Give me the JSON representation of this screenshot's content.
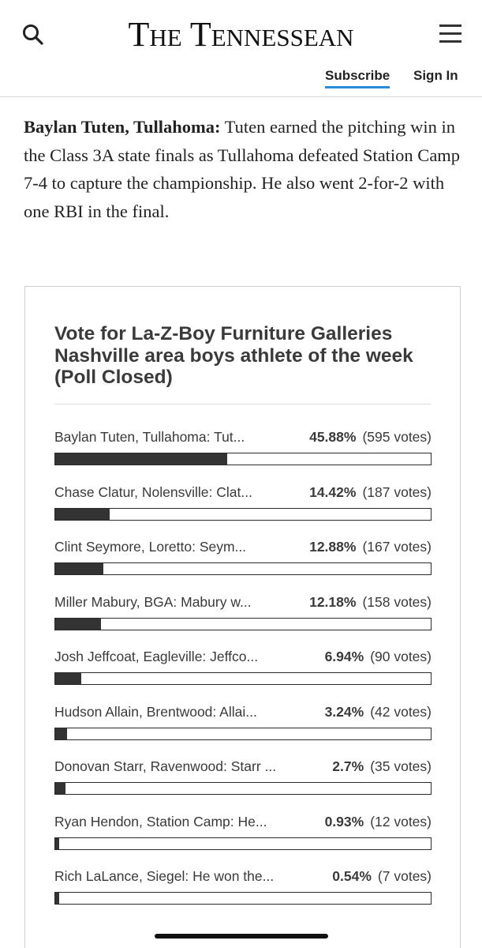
{
  "header": {
    "masthead": "The Tennessean",
    "subscribe_label": "Subscribe",
    "signin_label": "Sign In",
    "accent_color": "#2a8bd8"
  },
  "article": {
    "lead_name": "Baylan Tuten, Tullahoma:",
    "text": " Tuten earned the pitching win in the Class 3A state finals as Tullahoma defeated Station Camp 7-4 to capture the championship. He also went 2-for-2 with one RBI in the final."
  },
  "poll": {
    "title": "Vote for La-Z-Boy Furniture Galleries Nashville area boys athlete of the week (Poll Closed)",
    "options": [
      {
        "label": "Baylan Tuten, Tullahoma: Tut...",
        "percent_text": "45.88%",
        "votes_text": "(595 votes)",
        "percent": 45.88
      },
      {
        "label": "Chase Clatur, Nolensville: Clat...",
        "percent_text": "14.42%",
        "votes_text": "(187 votes)",
        "percent": 14.42
      },
      {
        "label": "Clint Seymore, Loretto: Seym...",
        "percent_text": "12.88%",
        "votes_text": "(167 votes)",
        "percent": 12.88
      },
      {
        "label": "Miller Mabury, BGA: Mabury w...",
        "percent_text": "12.18%",
        "votes_text": "(158 votes)",
        "percent": 12.18
      },
      {
        "label": "Josh Jeffcoat, Eagleville: Jeffco...",
        "percent_text": "6.94%",
        "votes_text": "(90 votes)",
        "percent": 6.94
      },
      {
        "label": "Hudson Allain, Brentwood: Allai...",
        "percent_text": "3.24%",
        "votes_text": "(42 votes)",
        "percent": 3.24
      },
      {
        "label": "Donovan Starr, Ravenwood: Starr ...",
        "percent_text": "2.7%",
        "votes_text": "(35 votes)",
        "percent": 2.7
      },
      {
        "label": "Ryan Hendon, Station Camp: He...",
        "percent_text": "0.93%",
        "votes_text": "(12 votes)",
        "percent": 0.93
      },
      {
        "label": "Rich LaLance, Siegel: He won the...",
        "percent_text": "0.54%",
        "votes_text": "(7 votes)",
        "percent": 0.54
      }
    ]
  }
}
